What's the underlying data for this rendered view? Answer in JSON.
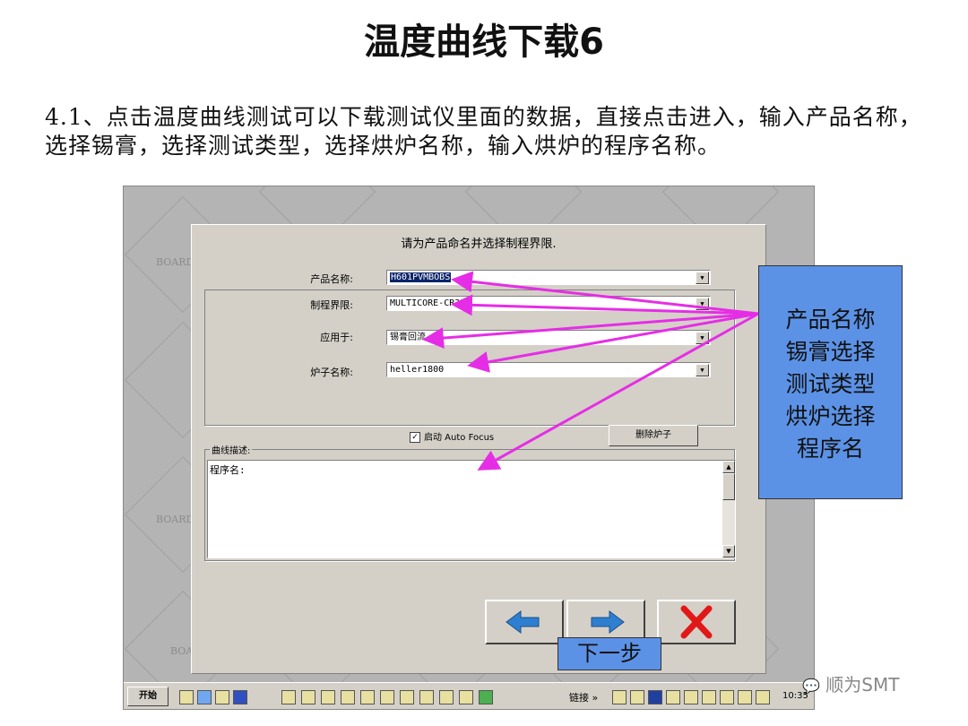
{
  "slide": {
    "title": "温度曲线下载6",
    "description": "4.1、点击温度曲线测试可以下载测试仪里面的数据，直接点击进入，输入产品名称，选择锡膏，选择测试类型，选择烘炉名称，输入烘炉的程序名称。"
  },
  "background": {
    "tile_word": "BOARD"
  },
  "dialog": {
    "heading": "请为产品命名并选择制程界限.",
    "product_name_label": "产品名称:",
    "product_name_value": "H601PVMBOBS",
    "process_limit_label": "制程界限:",
    "process_limit_value": "MULTICORE-CR32",
    "apply_to_label": "应用于:",
    "apply_to_value": "锡膏回流",
    "oven_name_label": "炉子名称:",
    "oven_name_value": "heller1800",
    "autofocus_label": "启动 Auto Focus",
    "autofocus_checked": "✓",
    "delete_oven_label": "删除炉子",
    "curve_desc_label": "曲线描述:",
    "curve_desc_text": "程序名:"
  },
  "taskbar": {
    "start_label": "开始",
    "links_label": "链接 »",
    "clock": "10:35"
  },
  "callout": {
    "lines": [
      "产品名称",
      "锡膏选择",
      "测试类型",
      "烘炉选择",
      "程序名"
    ]
  },
  "next_label": "下一步",
  "watermark": "顺为SMT",
  "colors": {
    "callout_bg": "#5c92e6",
    "arrow": "#e62de6",
    "selection": "#0a246a"
  },
  "icons": [
    "back-arrow-icon",
    "next-arrow-icon",
    "close-x-icon",
    "dropdown-arrow-icon",
    "wechat-icon"
  ]
}
